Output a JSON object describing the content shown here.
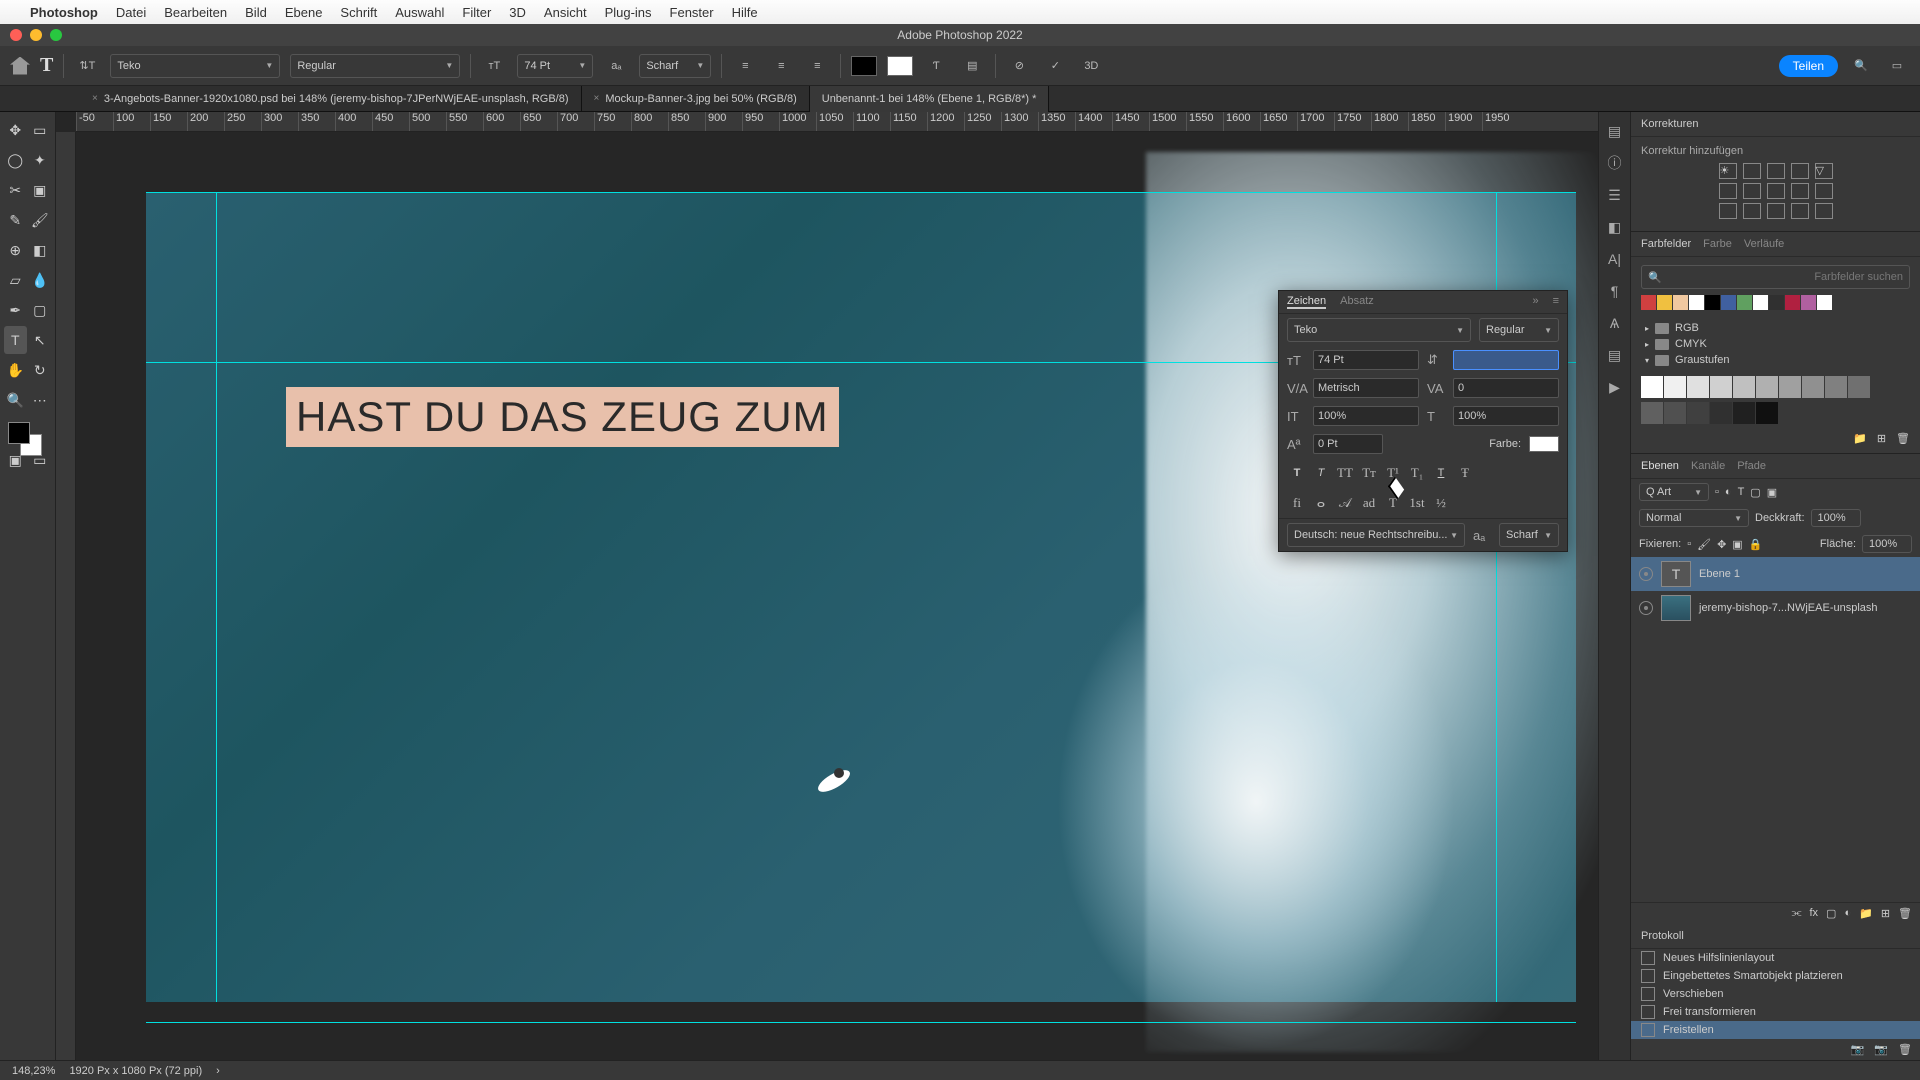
{
  "menu": {
    "app": "Photoshop",
    "items": [
      "Datei",
      "Bearbeiten",
      "Bild",
      "Ebene",
      "Schrift",
      "Auswahl",
      "Filter",
      "3D",
      "Ansicht",
      "Plug-ins",
      "Fenster",
      "Hilfe"
    ]
  },
  "window_title": "Adobe Photoshop 2022",
  "options": {
    "font": "Teko",
    "weight": "Regular",
    "size": "74 Pt",
    "aa": "Scharf",
    "share": "Teilen"
  },
  "tabs": [
    {
      "label": "3-Angebots-Banner-1920x1080.psd bei 148% (jeremy-bishop-7JPerNWjEAE-unsplash, RGB/8)",
      "active": false
    },
    {
      "label": "Mockup-Banner-3.jpg bei 50% (RGB/8)",
      "active": false
    },
    {
      "label": "Unbenannt-1 bei 148% (Ebene 1, RGB/8*) *",
      "active": true
    }
  ],
  "ruler": [
    "-50",
    "100",
    "150",
    "200",
    "250",
    "300",
    "350",
    "400",
    "450",
    "500",
    "550",
    "600",
    "650",
    "700",
    "750",
    "800",
    "850",
    "900",
    "950",
    "1000",
    "1050",
    "1100",
    "1150",
    "1200",
    "1250",
    "1300",
    "1350",
    "1400",
    "1450",
    "1500",
    "1550",
    "1600",
    "1650",
    "1700",
    "1750",
    "1800",
    "1850",
    "1900",
    "1950"
  ],
  "canvas_text": "HAST DU DAS ZEUG ZUM",
  "adjustments": {
    "title": "Korrekturen",
    "sub": "Korrektur hinzufügen"
  },
  "swatches": {
    "tabs": [
      "Farbfelder",
      "Farbe",
      "Verläufe"
    ],
    "search": "Farbfelder suchen",
    "groups": [
      "RGB",
      "CMYK",
      "Graustufen"
    ]
  },
  "swatch_colors": [
    "#d04040",
    "#f0c040",
    "#f0c8a0",
    "#ffffff",
    "#000000",
    "#4060a0",
    "#60a060",
    "#ffffff",
    "#303030",
    "#b02040",
    "#b060a0",
    "#ffffff"
  ],
  "grays": [
    "#ffffff",
    "#f0f0f0",
    "#e0e0e0",
    "#d0d0d0",
    "#c0c0c0",
    "#b0b0b0",
    "#a0a0a0",
    "#909090",
    "#808080",
    "#707070",
    "#606060",
    "#505050",
    "#404040",
    "#303030",
    "#202020",
    "#101010"
  ],
  "layers": {
    "tabs": [
      "Ebenen",
      "Kanäle",
      "Pfade"
    ],
    "kind": "Q Art",
    "blend": "Normal",
    "opacity_l": "Deckkraft:",
    "opacity_v": "100%",
    "lock": "Fixieren:",
    "fill_l": "Fläche:",
    "fill_v": "100%",
    "items": [
      {
        "name": "Ebene 1",
        "type": "T",
        "sel": true
      },
      {
        "name": "jeremy-bishop-7...NWjEAE-unsplash",
        "type": "img",
        "sel": false
      }
    ]
  },
  "history": {
    "title": "Protokoll",
    "items": [
      "Neues Hilfslinienlayout",
      "Eingebettetes Smartobjekt platzieren",
      "Verschieben",
      "Frei transformieren",
      "Freistellen"
    ]
  },
  "char": {
    "tabs": [
      "Zeichen",
      "Absatz"
    ],
    "font": "Teko",
    "weight": "Regular",
    "size": "74 Pt",
    "leading": "",
    "kerning": "Metrisch",
    "tracking": "0",
    "vscale": "100%",
    "hscale": "100%",
    "baseline": "0 Pt",
    "color_l": "Farbe:",
    "lang": "Deutsch: neue Rechtschreibu...",
    "aa": "Scharf"
  },
  "status": {
    "zoom": "148,23%",
    "dims": "1920 Px x 1080 Px (72 ppi)"
  }
}
